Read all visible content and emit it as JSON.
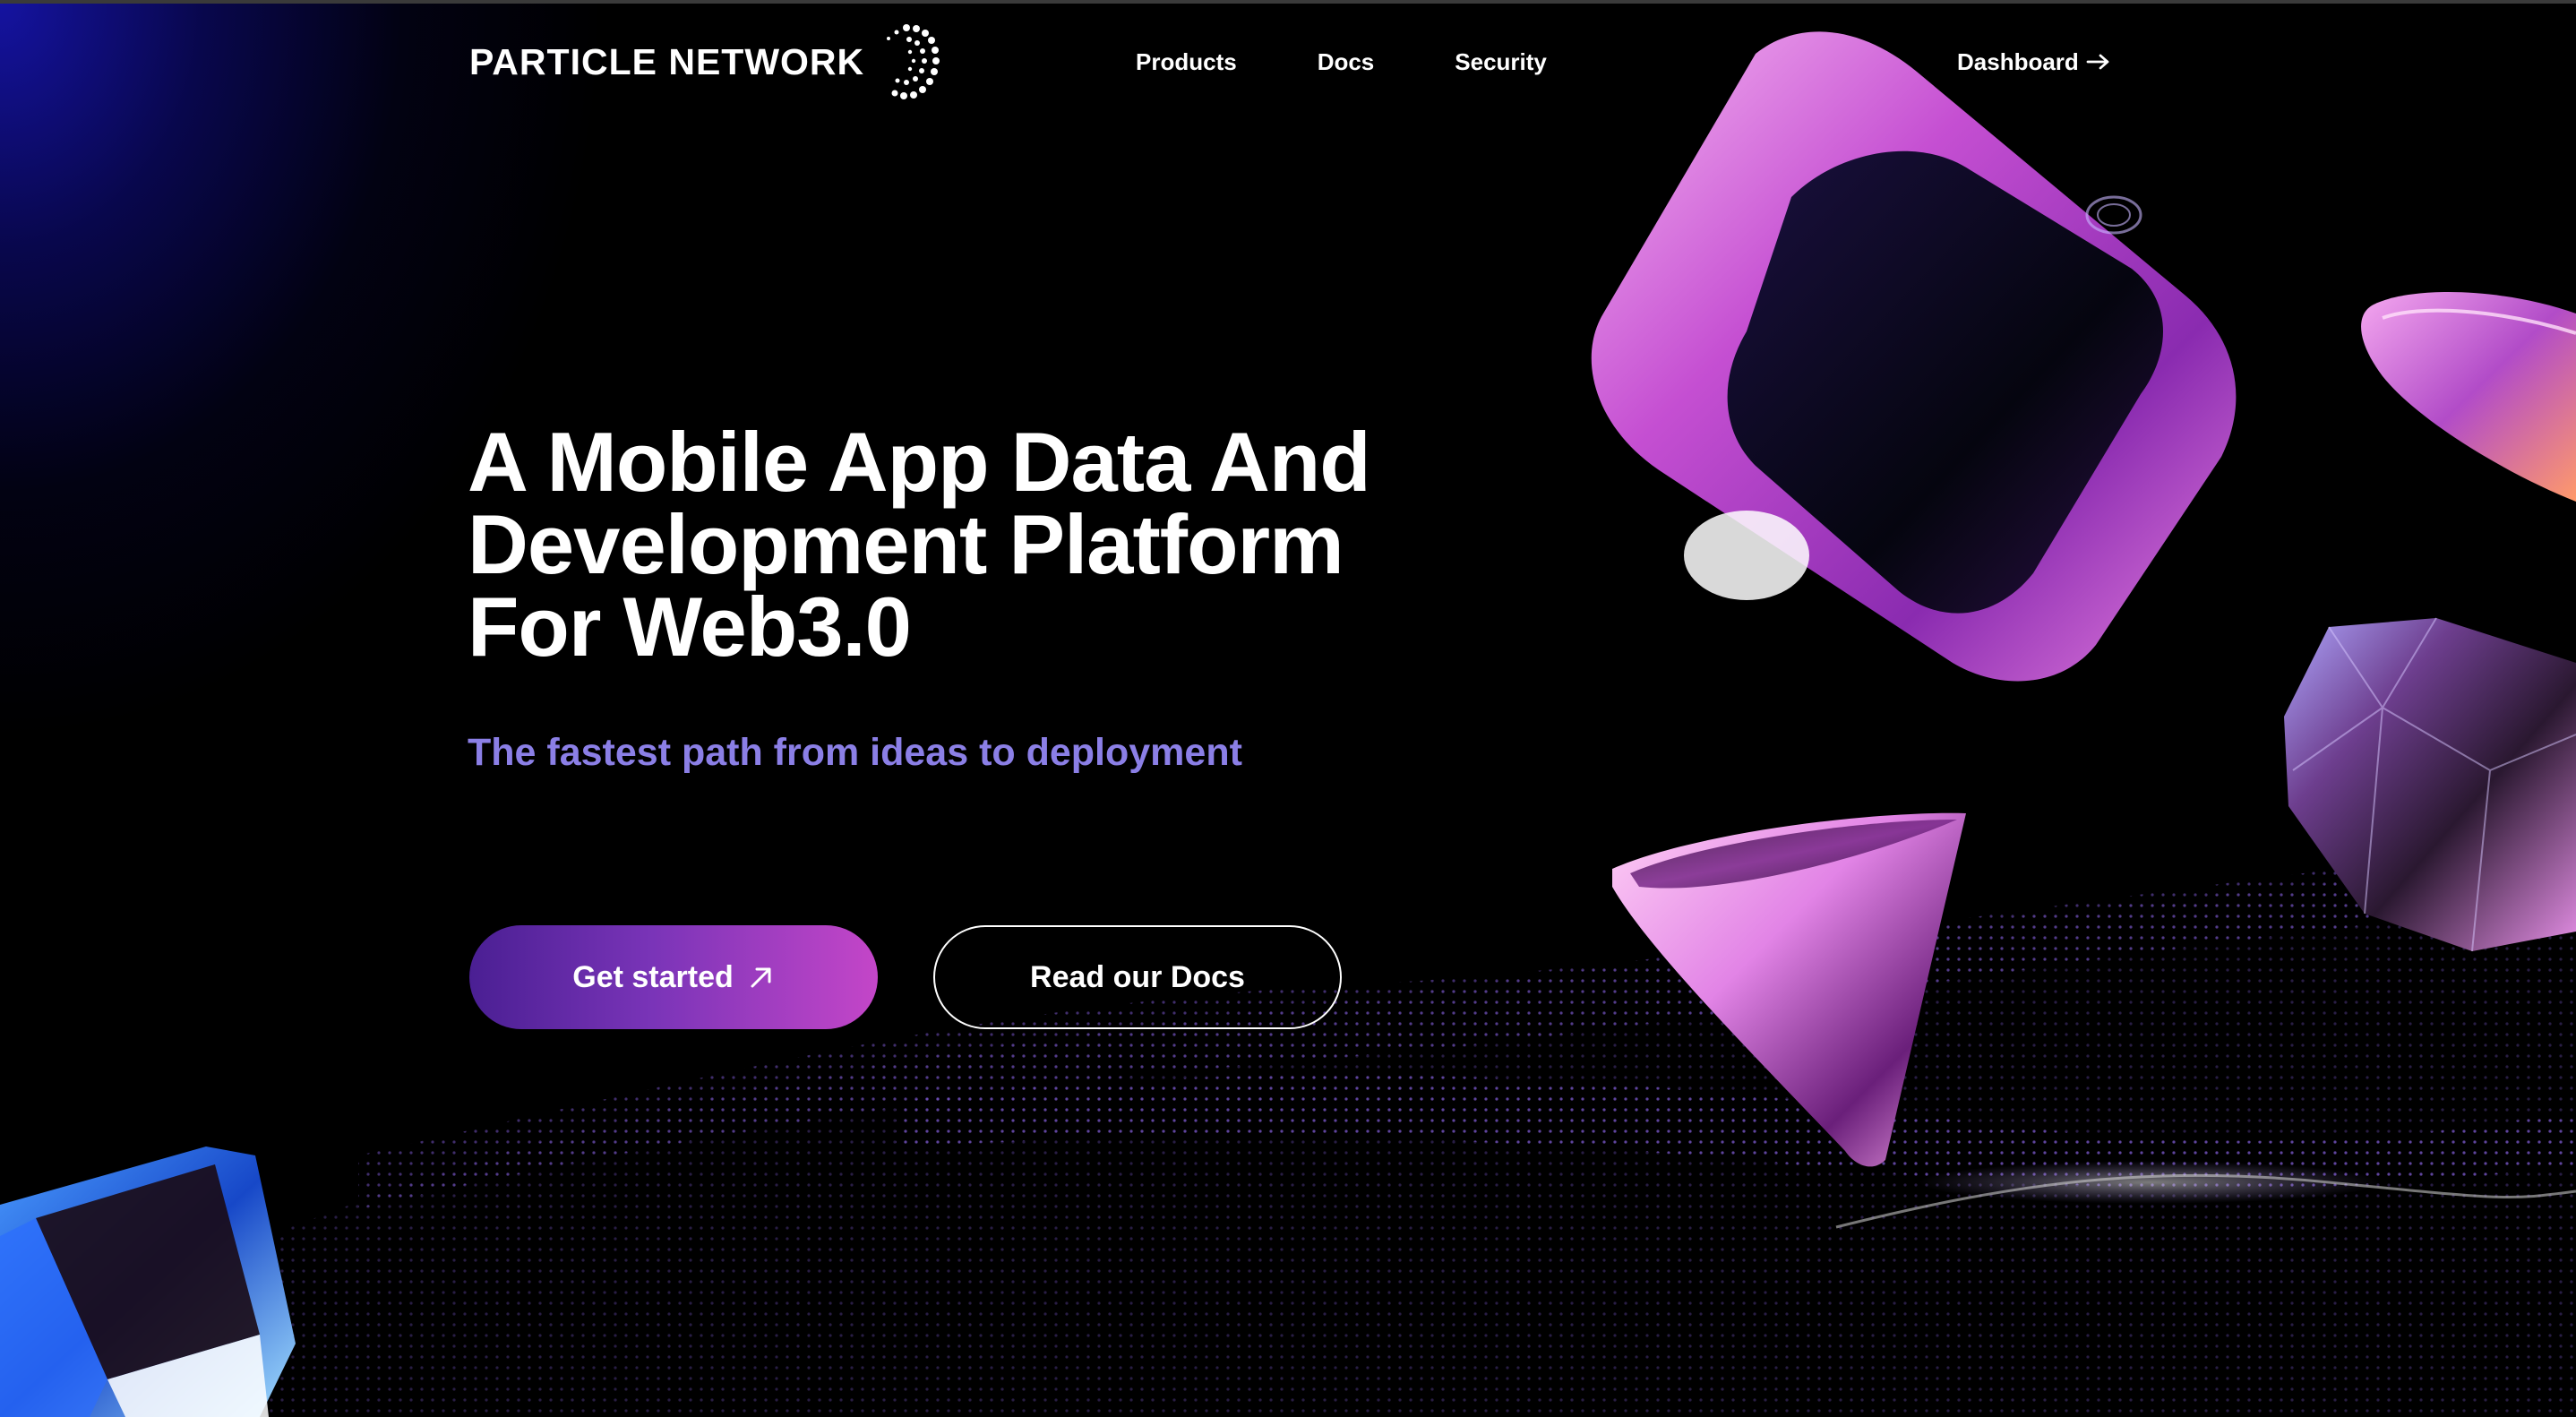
{
  "brand": {
    "name": "PARTICLE NETWORK",
    "logo_icon": "particle-dots-icon"
  },
  "nav": {
    "links": [
      "Products",
      "Docs",
      "Security"
    ],
    "dashboard_label": "Dashboard",
    "dashboard_icon": "arrow-right-icon"
  },
  "hero": {
    "title_lines": [
      "A Mobile App Data And",
      "Development Platform",
      "For Web3.0"
    ],
    "subtitle": "The fastest path from ideas to deployment",
    "primary_button": "Get started",
    "primary_button_icon": "arrow-up-right-icon",
    "secondary_button": "Read our Docs"
  },
  "colors": {
    "background": "#000000",
    "subtitle": "#8b7fe6",
    "button_gradient_start": "#4a1f93",
    "button_gradient_end": "#c446c8",
    "accent_pink": "#e070e0"
  }
}
